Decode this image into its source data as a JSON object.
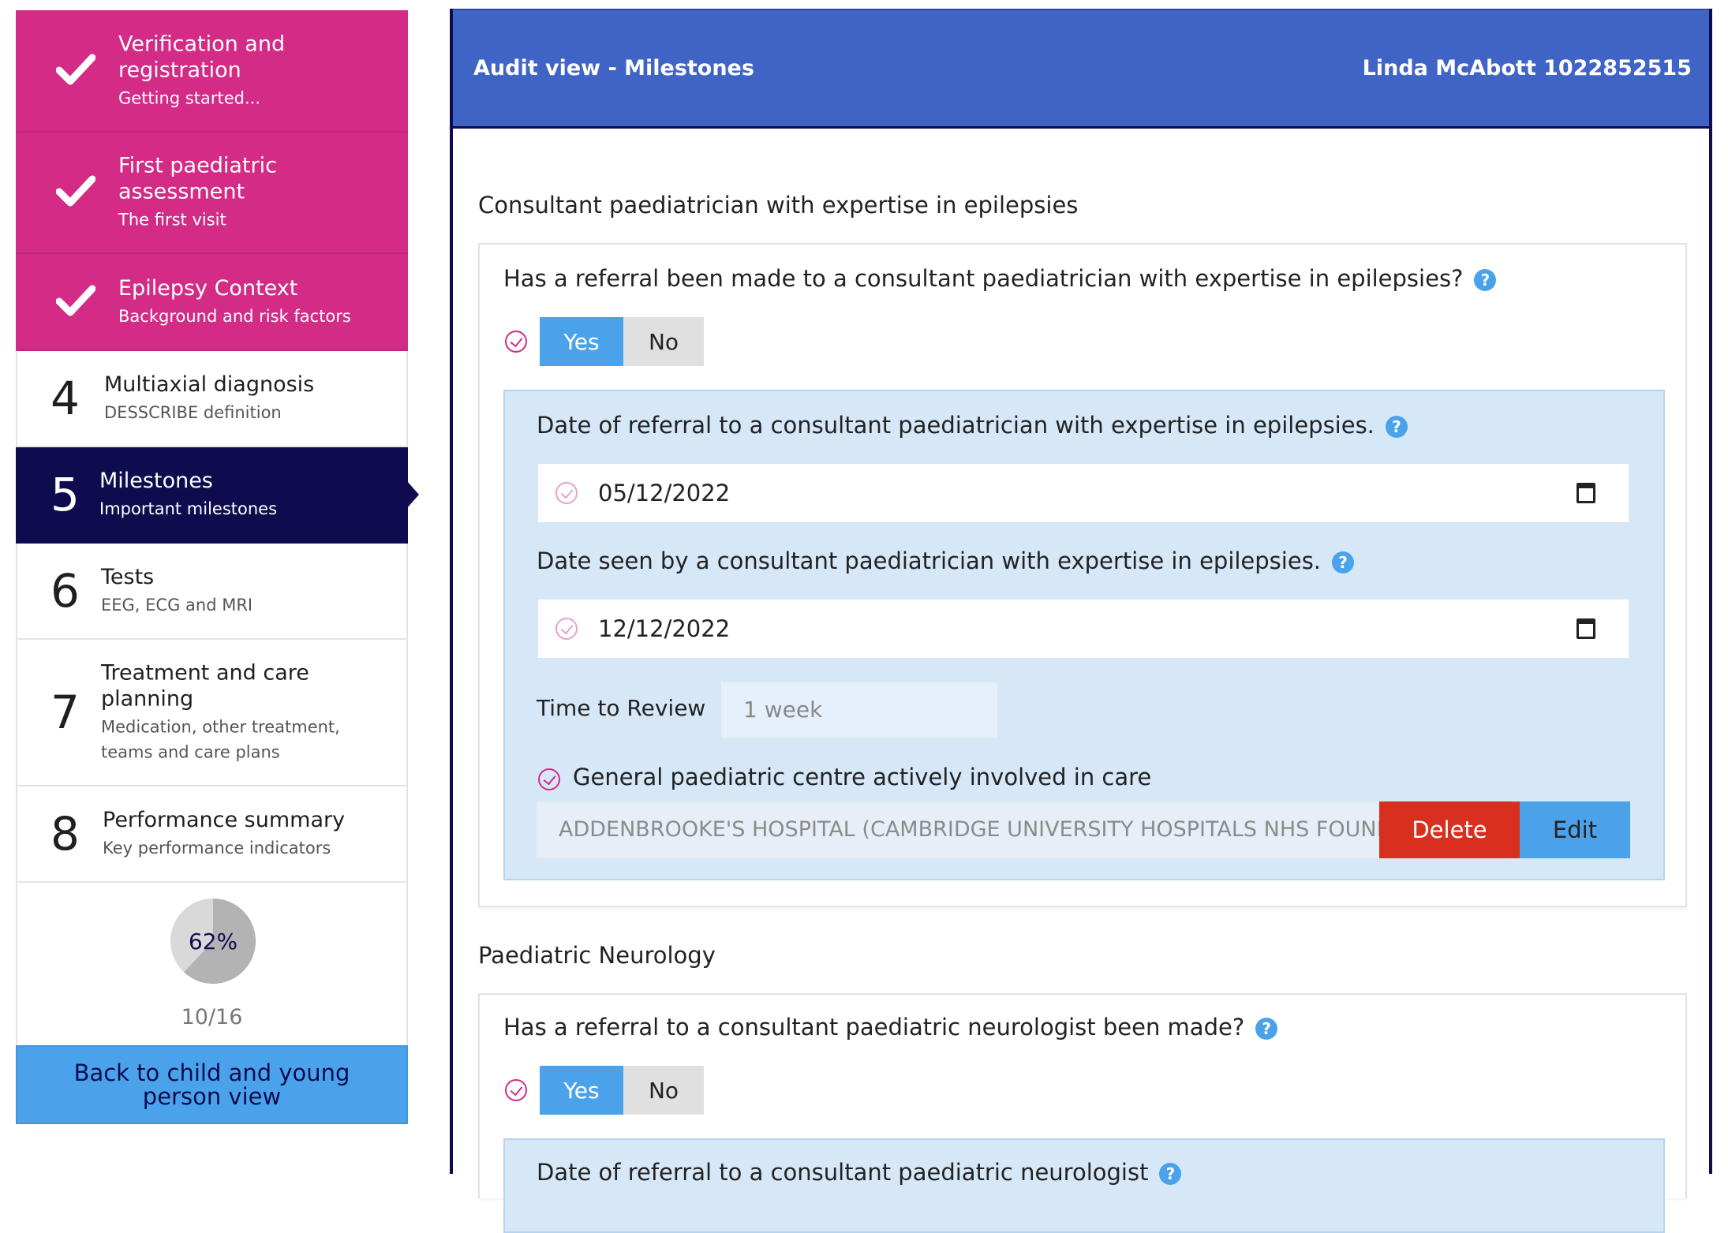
{
  "sidebar": {
    "steps": [
      {
        "title": "Verification and registration",
        "sub": "Getting started..."
      },
      {
        "title": "First paediatric assessment",
        "sub": "The first visit"
      },
      {
        "title": "Epilepsy Context",
        "sub": "Background and risk factors"
      },
      {
        "num": "4",
        "title": "Multiaxial diagnosis",
        "sub": "DESSCRIBE definition"
      },
      {
        "num": "5",
        "title": "Milestones",
        "sub": "Important milestones"
      },
      {
        "num": "6",
        "title": "Tests",
        "sub": "EEG, ECG and MRI"
      },
      {
        "num": "7",
        "title": "Treatment and care planning",
        "sub": "Medication, other treatment, teams and care plans"
      },
      {
        "num": "8",
        "title": "Performance summary",
        "sub": "Key performance indicators"
      }
    ],
    "progress": {
      "percent_label": "62%",
      "percent": 0.62,
      "count": "10/16"
    },
    "back_button": "Back to child and young person view"
  },
  "header": {
    "title": "Audit view - Milestones",
    "patient": "Linda McAbott 1022852515"
  },
  "section1": {
    "heading": "Consultant paediatrician with expertise in epilepsies",
    "question": "Has a referral been made to a consultant paediatrician with expertise in epilepsies?",
    "yes": "Yes",
    "no": "No",
    "date_referral_label": "Date of referral to a consultant paediatrician with expertise in epilepsies.",
    "date_referral_value": "05/12/2022",
    "date_seen_label": "Date seen by a consultant paediatrician with expertise in epilepsies.",
    "date_seen_value": "12/12/2022",
    "time_to_review_label": "Time to Review",
    "time_to_review_value": "1 week",
    "centre_label": "General paediatric centre actively involved in care",
    "centre_value": "ADDENBROOKE'S HOSPITAL (CAMBRIDGE UNIVERSITY HOSPITALS NHS FOUNDATION TRUST)",
    "delete": "Delete",
    "edit": "Edit"
  },
  "section2": {
    "heading": "Paediatric Neurology",
    "question": "Has a referral to a consultant paediatric neurologist been made?",
    "yes": "Yes",
    "no": "No",
    "date_referral_label": "Date of referral to a consultant paediatric neurologist"
  },
  "colors": {
    "done": "#d42b87",
    "active": "#0e0c4f",
    "header": "#4064c6",
    "accent": "#4aa3ea",
    "delete": "#d8301e"
  }
}
